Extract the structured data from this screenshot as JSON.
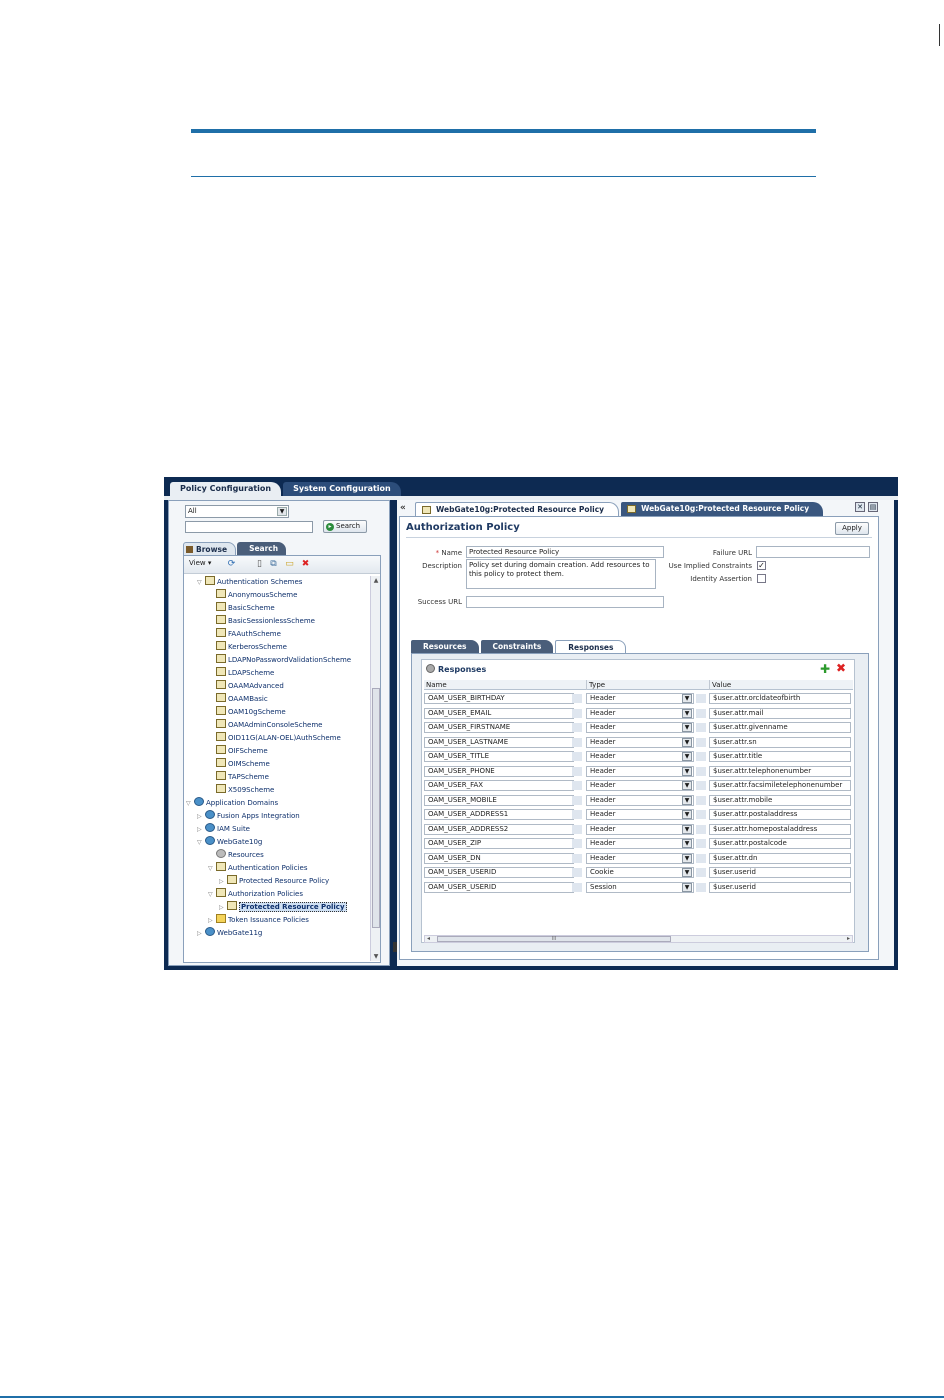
{
  "app": {
    "top_tabs": [
      "Policy Configuration",
      "System Configuration"
    ],
    "corner_mark": "˜"
  },
  "left_panel": {
    "filter_select": "All",
    "search_button": "Search",
    "tabs": [
      "Browse",
      "Search"
    ],
    "view_menu": "View ▾",
    "toolbar_icons": [
      "refresh-icon",
      "new-icon",
      "copy-icon",
      "open-icon",
      "delete-icon"
    ],
    "tree": [
      {
        "label": "Authentication Schemes",
        "level": 1,
        "twisty": "▽",
        "icon": "scheme"
      },
      {
        "label": "AnonymousScheme",
        "level": 2,
        "twisty": "",
        "icon": "scheme"
      },
      {
        "label": "BasicScheme",
        "level": 2,
        "twisty": "",
        "icon": "scheme"
      },
      {
        "label": "BasicSessionlessScheme",
        "level": 2,
        "twisty": "",
        "icon": "scheme"
      },
      {
        "label": "FAAuthScheme",
        "level": 2,
        "twisty": "",
        "icon": "scheme"
      },
      {
        "label": "KerberosScheme",
        "level": 2,
        "twisty": "",
        "icon": "scheme"
      },
      {
        "label": "LDAPNoPasswordValidationScheme",
        "level": 2,
        "twisty": "",
        "icon": "scheme"
      },
      {
        "label": "LDAPScheme",
        "level": 2,
        "twisty": "",
        "icon": "scheme"
      },
      {
        "label": "OAAMAdvanced",
        "level": 2,
        "twisty": "",
        "icon": "scheme"
      },
      {
        "label": "OAAMBasic",
        "level": 2,
        "twisty": "",
        "icon": "scheme"
      },
      {
        "label": "OAM10gScheme",
        "level": 2,
        "twisty": "",
        "icon": "scheme"
      },
      {
        "label": "OAMAdminConsoleScheme",
        "level": 2,
        "twisty": "",
        "icon": "scheme"
      },
      {
        "label": "OID11G(ALAN-OEL)AuthScheme",
        "level": 2,
        "twisty": "",
        "icon": "scheme"
      },
      {
        "label": "OIFScheme",
        "level": 2,
        "twisty": "",
        "icon": "scheme"
      },
      {
        "label": "OIMScheme",
        "level": 2,
        "twisty": "",
        "icon": "scheme"
      },
      {
        "label": "TAPScheme",
        "level": 2,
        "twisty": "",
        "icon": "scheme"
      },
      {
        "label": "X509Scheme",
        "level": 2,
        "twisty": "",
        "icon": "scheme"
      },
      {
        "label": "Application Domains",
        "level": 0,
        "twisty": "▽",
        "icon": "globe"
      },
      {
        "label": "Fusion Apps Integration",
        "level": 1,
        "twisty": "▷",
        "icon": "globe"
      },
      {
        "label": "IAM Suite",
        "level": 1,
        "twisty": "▷",
        "icon": "globe"
      },
      {
        "label": "WebGate10g",
        "level": 1,
        "twisty": "▽",
        "icon": "globe"
      },
      {
        "label": "Resources",
        "level": 2,
        "twisty": "",
        "icon": "gear"
      },
      {
        "label": "Authentication Policies",
        "level": 2,
        "twisty": "▽",
        "icon": "scheme"
      },
      {
        "label": "Protected Resource Policy",
        "level": 3,
        "twisty": "▷",
        "icon": "scheme"
      },
      {
        "label": "Authorization Policies",
        "level": 2,
        "twisty": "▽",
        "icon": "scheme"
      },
      {
        "label": "Protected Resource Policy",
        "level": 3,
        "twisty": "▷",
        "icon": "scheme",
        "selected": true
      },
      {
        "label": "Token Issuance Policies",
        "level": 2,
        "twisty": "▷",
        "icon": "folder"
      },
      {
        "label": "WebGate11g",
        "level": 1,
        "twisty": "▷",
        "icon": "globe"
      }
    ]
  },
  "right_panel": {
    "collapse": "«",
    "tabs": [
      "WebGate10g:Protected Resource Policy",
      "WebGate10g:Protected Resource Policy"
    ],
    "title": "Authorization Policy",
    "apply": "Apply",
    "form": {
      "name_label": "Name",
      "name_required": "*",
      "name_value": "Protected Resource Policy",
      "description_label": "Description",
      "description_value": "Policy set during domain creation. Add resources to this policy to protect them.",
      "success_url_label": "Success URL",
      "failure_url_label": "Failure URL",
      "implied_label": "Use Implied Constraints",
      "implied_checked": "✓",
      "identity_label": "Identity Assertion"
    },
    "subtabs": [
      "Resources",
      "Constraints",
      "Responses"
    ],
    "responses": {
      "title": "Responses",
      "add": "✚",
      "remove": "✖",
      "columns": [
        "Name",
        "Type",
        "Value"
      ],
      "rows": [
        {
          "name": "OAM_USER_BIRTHDAY",
          "type": "Header",
          "value": "$user.attr.orcldateofbirth"
        },
        {
          "name": "OAM_USER_EMAIL",
          "type": "Header",
          "value": "$user.attr.mail"
        },
        {
          "name": "OAM_USER_FIRSTNAME",
          "type": "Header",
          "value": "$user.attr.givenname"
        },
        {
          "name": "OAM_USER_LASTNAME",
          "type": "Header",
          "value": "$user.attr.sn"
        },
        {
          "name": "OAM_USER_TITLE",
          "type": "Header",
          "value": "$user.attr.title"
        },
        {
          "name": "OAM_USER_PHONE",
          "type": "Header",
          "value": "$user.attr.telephonenumber"
        },
        {
          "name": "OAM_USER_FAX",
          "type": "Header",
          "value": "$user.attr.facsimiletelephonenumber"
        },
        {
          "name": "OAM_USER_MOBILE",
          "type": "Header",
          "value": "$user.attr.mobile"
        },
        {
          "name": "OAM_USER_ADDRESS1",
          "type": "Header",
          "value": "$user.attr.postaladdress"
        },
        {
          "name": "OAM_USER_ADDRESS2",
          "type": "Header",
          "value": "$user.attr.homepostaladdress"
        },
        {
          "name": "OAM_USER_ZIP",
          "type": "Header",
          "value": "$user.attr.postalcode"
        },
        {
          "name": "OAM_USER_DN",
          "type": "Header",
          "value": "$user.attr.dn"
        },
        {
          "name": "OAM_USER_USERID",
          "type": "Cookie",
          "value": "$user.userid"
        },
        {
          "name": "OAM_USER_USERID",
          "type": "Session",
          "value": "$user.userid"
        }
      ],
      "scroll_thumb": "III"
    }
  }
}
